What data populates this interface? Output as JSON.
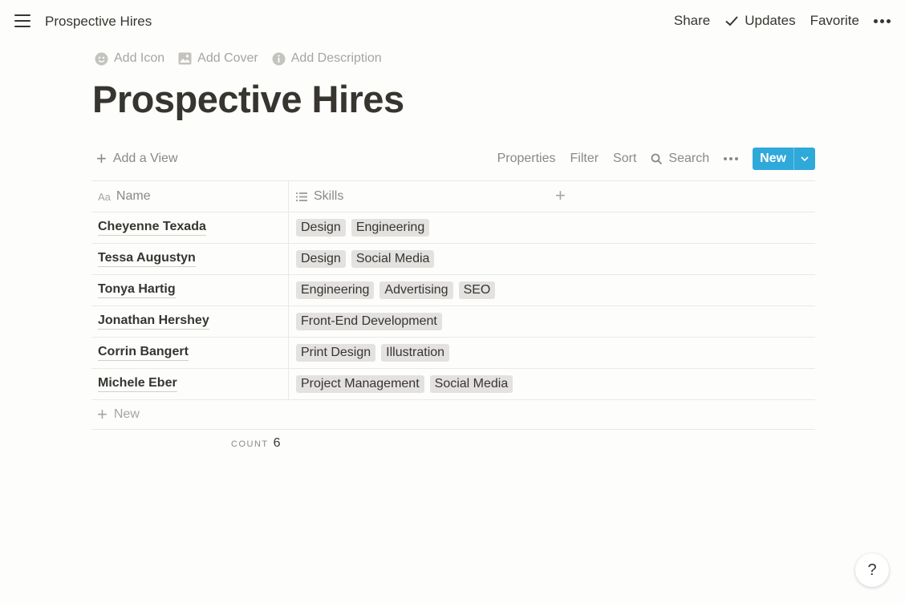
{
  "topbar": {
    "title": "Prospective Hires",
    "share": "Share",
    "updates": "Updates",
    "favorite": "Favorite"
  },
  "page_controls": {
    "add_icon": "Add Icon",
    "add_cover": "Add Cover",
    "add_description": "Add Description"
  },
  "page_title": "Prospective Hires",
  "toolbar": {
    "add_view": "Add a View",
    "properties": "Properties",
    "filter": "Filter",
    "sort": "Sort",
    "search": "Search",
    "new": "New"
  },
  "table": {
    "columns": [
      {
        "icon": "Aa",
        "label": "Name"
      },
      {
        "icon": "list-icon",
        "label": "Skills"
      }
    ],
    "rows": [
      {
        "name": "Cheyenne Texada",
        "skills": [
          "Design",
          "Engineering"
        ]
      },
      {
        "name": "Tessa Augustyn",
        "skills": [
          "Design",
          "Social Media"
        ]
      },
      {
        "name": "Tonya Hartig",
        "skills": [
          "Engineering",
          "Advertising",
          "SEO"
        ]
      },
      {
        "name": "Jonathan Hershey",
        "skills": [
          "Front-End Development"
        ]
      },
      {
        "name": "Corrin Bangert",
        "skills": [
          "Print Design",
          "Illustration"
        ]
      },
      {
        "name": "Michele Eber",
        "skills": [
          "Project Management",
          "Social Media"
        ]
      }
    ],
    "new_row": "New"
  },
  "count": {
    "label": "COUNT",
    "value": "6"
  },
  "help": "?",
  "colors": {
    "accent": "#2ea9da",
    "tag_bg": "#e3e2e0",
    "text": "#37352f",
    "muted": "#8a8985"
  }
}
